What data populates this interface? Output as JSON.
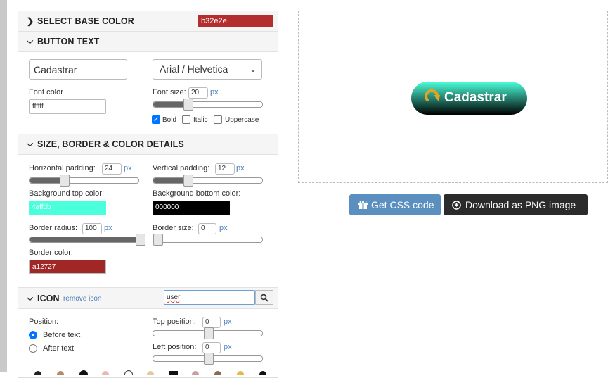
{
  "sections": {
    "base_color": {
      "title": "SELECT BASE COLOR",
      "value": "b32e2e",
      "color": "#b32e2e"
    },
    "button_text": {
      "title": "BUTTON TEXT"
    },
    "size": {
      "title": "SIZE, BORDER & COLOR DETAILS"
    },
    "icon": {
      "title": "ICON",
      "remove_label": "remove icon"
    }
  },
  "button_text": {
    "text_value": "Cadastrar",
    "font_family": "Arial / Helvetica",
    "font_color_label": "Font color",
    "font_color_value": "ffffff",
    "font_size_label": "Font size:",
    "font_size_value": "20",
    "unit": "px",
    "font_size_fraction": 0.3,
    "bold_label": "Bold",
    "italic_label": "Italic",
    "uppercase_label": "Uppercase",
    "bold_checked": true,
    "italic_checked": false,
    "uppercase_checked": false
  },
  "size": {
    "h_padding_label": "Horizontal padding:",
    "h_padding_value": "24",
    "h_padding_fraction": 0.3,
    "v_padding_label": "Vertical padding:",
    "v_padding_value": "12",
    "v_padding_fraction": 0.3,
    "bg_top_label": "Background top color:",
    "bg_top_value": "4affdb",
    "bg_top_color": "#4affdb",
    "bg_bottom_label": "Background bottom color:",
    "bg_bottom_value": "000000",
    "bg_bottom_color": "#000000",
    "border_radius_label": "Border radius:",
    "border_radius_value": "100",
    "border_radius_fraction": 1.0,
    "border_size_label": "Border size:",
    "border_size_value": "0",
    "border_size_fraction": 0.0,
    "border_color_label": "Border color:",
    "border_color_value": "a12727",
    "border_color_color": "#a12727",
    "unit": "px"
  },
  "icon": {
    "search_value": "user",
    "position_label": "Position:",
    "before_label": "Before text",
    "after_label": "After text",
    "before_selected": true,
    "top_position_label": "Top position:",
    "top_position_value": "0",
    "top_position_fraction": 0.5,
    "left_position_label": "Left position:",
    "left_position_value": "0",
    "left_position_fraction": 0.5,
    "unit": "px"
  },
  "preview": {
    "button_label": "Cadastrar",
    "icon": "redo-arrow-icon"
  },
  "actions": {
    "css_label": "Get CSS code",
    "css_icon": "gift-icon",
    "css_color": "#5b8fc0",
    "png_label": "Download as PNG image",
    "png_icon": "download-circle-icon",
    "png_color": "#2b2b2b"
  }
}
